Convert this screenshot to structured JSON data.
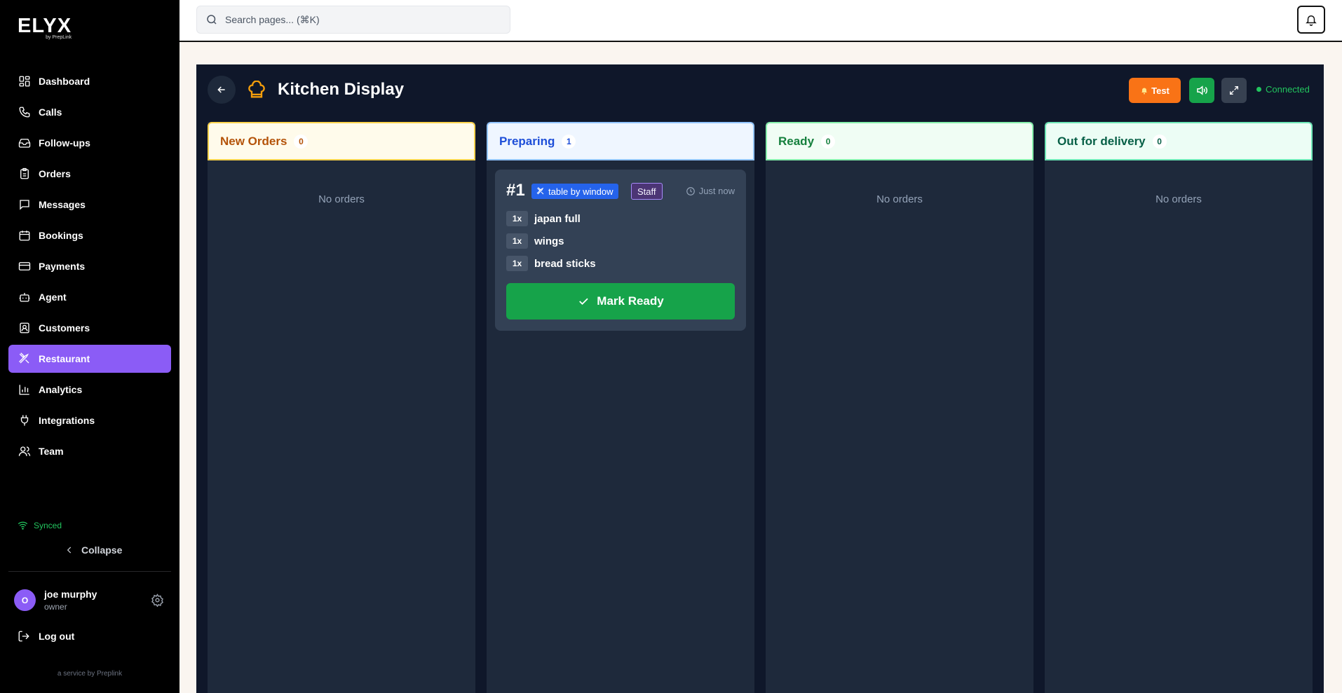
{
  "brand": {
    "name": "ELYX",
    "sub": "by PrepLink"
  },
  "sidebar": {
    "items": [
      {
        "label": "Dashboard",
        "icon": "dashboard-icon"
      },
      {
        "label": "Calls",
        "icon": "phone-icon"
      },
      {
        "label": "Follow-ups",
        "icon": "inbox-icon"
      },
      {
        "label": "Orders",
        "icon": "clipboard-icon"
      },
      {
        "label": "Messages",
        "icon": "message-icon"
      },
      {
        "label": "Bookings",
        "icon": "calendar-icon"
      },
      {
        "label": "Payments",
        "icon": "credit-card-icon"
      },
      {
        "label": "Agent",
        "icon": "bot-icon"
      },
      {
        "label": "Customers",
        "icon": "contact-icon"
      },
      {
        "label": "Restaurant",
        "icon": "utensils-icon",
        "active": true
      },
      {
        "label": "Analytics",
        "icon": "bar-chart-icon"
      },
      {
        "label": "Integrations",
        "icon": "plug-icon"
      },
      {
        "label": "Team",
        "icon": "users-icon"
      }
    ],
    "status": "Synced",
    "collapse_label": "Collapse",
    "user": {
      "initial": "O",
      "name": "joe murphy",
      "role": "owner"
    },
    "logout_label": "Log out",
    "service_text": "a service by Preplink"
  },
  "topbar": {
    "search_placeholder": "Search pages... (⌘K)"
  },
  "kitchen": {
    "title": "Kitchen Display",
    "test_label": "Test",
    "status": "Connected",
    "columns": [
      {
        "title": "New Orders",
        "count": "0",
        "empty": "No orders"
      },
      {
        "title": "Preparing",
        "count": "1"
      },
      {
        "title": "Ready",
        "count": "0",
        "empty": "No orders"
      },
      {
        "title": "Out for delivery",
        "count": "0",
        "empty": "No orders"
      }
    ],
    "order": {
      "number": "#1",
      "table": "table by window",
      "source": "Staff",
      "time": "Just now",
      "items": [
        {
          "qty": "1x",
          "name": "japan full"
        },
        {
          "qty": "1x",
          "name": "wings"
        },
        {
          "qty": "1x",
          "name": "bread sticks"
        }
      ],
      "action_label": "Mark Ready"
    }
  },
  "colors": {
    "accent": "#8b5cf6",
    "new_orders": "#b45309",
    "preparing": "#1d4ed8",
    "ready": "#15803d",
    "out_for_delivery": "#065f46",
    "connected": "#22c55e",
    "test_button": "#f97316"
  }
}
